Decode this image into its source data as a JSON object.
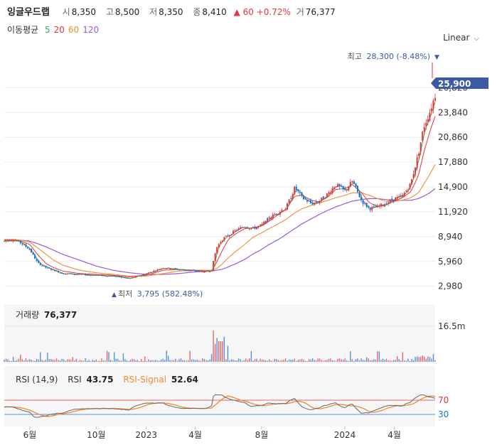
{
  "header": {
    "name": "잉글우드랩",
    "open_label": "시",
    "open": "8,350",
    "high_label": "고",
    "high": "8,500",
    "low_label": "저",
    "low": "8,350",
    "close_label": "종",
    "close": "8,410",
    "change": "▲ 60",
    "change_pct": "+0.72%",
    "volume_label": "거",
    "volume": "76,377"
  },
  "moving_average": {
    "label": "이동평균",
    "periods": [
      {
        "period": "5",
        "color": "#2bb24c"
      },
      {
        "period": "20",
        "color": "#e8333a"
      },
      {
        "period": "60",
        "color": "#f28b30"
      },
      {
        "period": "120",
        "color": "#9b59d6"
      }
    ]
  },
  "scale_selector": {
    "value": "Linear",
    "icon": "chevron-down-icon"
  },
  "colors": {
    "up": "#e8333a",
    "down": "#1e6fd9",
    "ma5": "#2bb24c",
    "ma20": "#e8333a",
    "ma60": "#f28b30",
    "ma120": "#9b59d6",
    "current_price_bg": "#3b5aa6",
    "rsi": "#666666",
    "rsi_signal": "#f28b30",
    "accent": "#3b5aa6"
  },
  "chart_data": [
    {
      "type": "candlestick",
      "y_axis": {
        "ticks": [
          "26,820",
          "23,840",
          "20,860",
          "17,880",
          "14,900",
          "11,920",
          "8,940",
          "5,960",
          "2,980"
        ],
        "ylim": [
          1500,
          29500
        ],
        "scale": "linear"
      },
      "x_axis": {
        "ticks": [
          "6월",
          "10월",
          "2023",
          "4월",
          "8월",
          "2024",
          "4월"
        ]
      },
      "current_price": "25,900",
      "high_annotation": {
        "label": "최고",
        "value": "28,300 (-8.48%)",
        "marker": "▼"
      },
      "low_annotation": {
        "label": "최저",
        "value": "3,795 (582.48%)",
        "marker": "▲"
      },
      "price_series": {
        "x": [
          "2022-04-15",
          "2022-05-01",
          "2022-05-15",
          "2022-06-01",
          "2022-06-15",
          "2022-07-01",
          "2022-07-15",
          "2022-08-01",
          "2022-09-01",
          "2022-10-01",
          "2022-11-01",
          "2022-12-01",
          "2023-01-01",
          "2023-02-01",
          "2023-03-01",
          "2023-04-01",
          "2023-04-20",
          "2023-05-01",
          "2023-05-10",
          "2023-05-20",
          "2023-06-01",
          "2023-06-15",
          "2023-07-01",
          "2023-07-15",
          "2023-08-01",
          "2023-08-15",
          "2023-09-01",
          "2023-09-15",
          "2023-10-01",
          "2023-10-15",
          "2023-11-01",
          "2023-11-15",
          "2023-12-01",
          "2023-12-15",
          "2024-01-01",
          "2024-01-15",
          "2024-02-01",
          "2024-02-15",
          "2024-03-01",
          "2024-03-15",
          "2024-04-01",
          "2024-04-15",
          "2024-05-01",
          "2024-05-15",
          "2024-05-25",
          "2024-06-05",
          "2024-06-15"
        ],
        "close": [
          8400,
          8600,
          8200,
          7400,
          5800,
          5200,
          4900,
          4500,
          4400,
          4300,
          4200,
          3900,
          4500,
          5200,
          5000,
          4800,
          4700,
          4900,
          7600,
          8600,
          9100,
          9700,
          10200,
          9900,
          10300,
          11200,
          11900,
          12400,
          14800,
          13600,
          12900,
          13200,
          14100,
          15200,
          14400,
          15600,
          13200,
          12300,
          12500,
          12900,
          13500,
          13700,
          15300,
          18800,
          22100,
          23900,
          25900
        ]
      },
      "ma_series": {
        "ma20": [
          8500,
          8500,
          8400,
          8000,
          6800,
          5700,
          5200,
          4800,
          4500,
          4400,
          4300,
          4100,
          4300,
          4900,
          5000,
          4900,
          4800,
          4800,
          5800,
          7200,
          8600,
          9300,
          9900,
          10000,
          10200,
          10800,
          11600,
          12200,
          13800,
          13900,
          13300,
          13100,
          13700,
          14600,
          14700,
          15200,
          14200,
          13000,
          12600,
          12700,
          13200,
          13600,
          14300,
          16200,
          19000,
          21500,
          23400
        ],
        "ma60": [
          8600,
          8600,
          8500,
          8300,
          7600,
          6800,
          6100,
          5500,
          4900,
          4600,
          4400,
          4200,
          4200,
          4500,
          4800,
          4900,
          4900,
          4900,
          5100,
          5600,
          6400,
          7200,
          8000,
          8800,
          9400,
          9900,
          10500,
          11000,
          11800,
          12300,
          12700,
          13000,
          13300,
          13600,
          13900,
          14200,
          14200,
          13900,
          13500,
          13200,
          13200,
          13300,
          13600,
          14200,
          15200,
          16400,
          17600
        ],
        "ma120": [
          8500,
          8500,
          8500,
          8400,
          8100,
          7700,
          7300,
          6800,
          6100,
          5400,
          4900,
          4600,
          4400,
          4400,
          4500,
          4700,
          4800,
          4800,
          4900,
          5000,
          5300,
          5700,
          6200,
          6800,
          7400,
          8000,
          8600,
          9200,
          9900,
          10500,
          11100,
          11600,
          12100,
          12500,
          12900,
          13200,
          13400,
          13500,
          13500,
          13400,
          13300,
          13300,
          13300,
          13500,
          13800,
          14200,
          14700
        ]
      }
    },
    {
      "type": "bar",
      "label": "거래량",
      "value": "76,377",
      "y_axis": {
        "ticks": [
          "16.5m"
        ]
      }
    },
    {
      "type": "line",
      "label": "RSI (14,9)",
      "series": [
        {
          "name": "RSI",
          "value": "43.75"
        },
        {
          "name": "RSI-Signal",
          "value": "52.64"
        }
      ],
      "y_axis": {
        "ticks": [
          "70",
          "30"
        ]
      }
    }
  ]
}
